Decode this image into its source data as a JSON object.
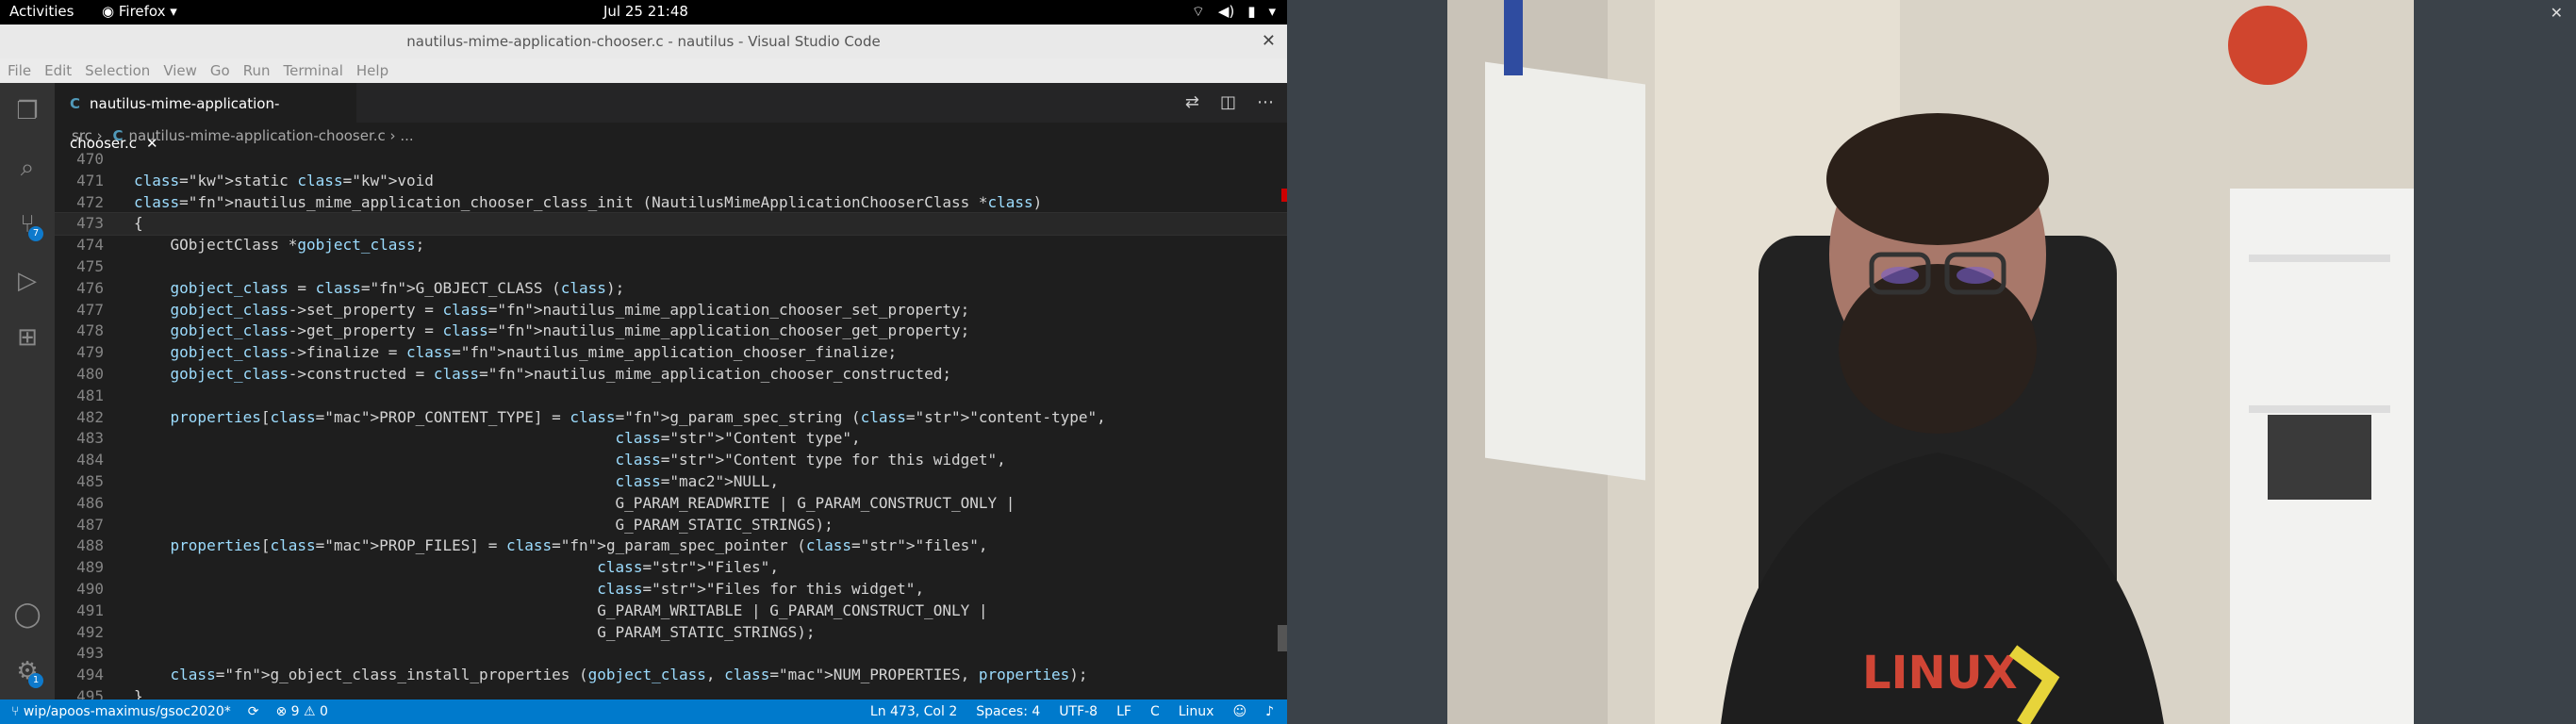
{
  "topbar": {
    "activities": "Activities",
    "app": "Firefox",
    "clock": "Jul 25  21:48"
  },
  "window": {
    "title": "nautilus-mime-application-chooser.c - nautilus - Visual Studio Code"
  },
  "menu": [
    "File",
    "Edit",
    "Selection",
    "View",
    "Go",
    "Run",
    "Terminal",
    "Help"
  ],
  "activity": {
    "scm_badge": "7",
    "settings_badge": "1"
  },
  "tab": {
    "label": "nautilus-mime-application-chooser.c",
    "lang": "C"
  },
  "breadcrumb": {
    "folder": "src",
    "file": "nautilus-mime-application-chooser.c",
    "more": "..."
  },
  "code": [
    {
      "n": "470",
      "t": ""
    },
    {
      "n": "471",
      "t": "static void"
    },
    {
      "n": "472",
      "t": "nautilus_mime_application_chooser_class_init (NautilusMimeApplicationChooserClass *class)"
    },
    {
      "n": "473",
      "t": "{"
    },
    {
      "n": "474",
      "t": "    GObjectClass *gobject_class;"
    },
    {
      "n": "475",
      "t": ""
    },
    {
      "n": "476",
      "t": "    gobject_class = G_OBJECT_CLASS (class);"
    },
    {
      "n": "477",
      "t": "    gobject_class->set_property = nautilus_mime_application_chooser_set_property;"
    },
    {
      "n": "478",
      "t": "    gobject_class->get_property = nautilus_mime_application_chooser_get_property;"
    },
    {
      "n": "479",
      "t": "    gobject_class->finalize = nautilus_mime_application_chooser_finalize;"
    },
    {
      "n": "480",
      "t": "    gobject_class->constructed = nautilus_mime_application_chooser_constructed;"
    },
    {
      "n": "481",
      "t": ""
    },
    {
      "n": "482",
      "t": "    properties[PROP_CONTENT_TYPE] = g_param_spec_string (\"content-type\","
    },
    {
      "n": "483",
      "t": "                                                     \"Content type\","
    },
    {
      "n": "484",
      "t": "                                                     \"Content type for this widget\","
    },
    {
      "n": "485",
      "t": "                                                     NULL,"
    },
    {
      "n": "486",
      "t": "                                                     G_PARAM_READWRITE | G_PARAM_CONSTRUCT_ONLY |"
    },
    {
      "n": "487",
      "t": "                                                     G_PARAM_STATIC_STRINGS);"
    },
    {
      "n": "488",
      "t": "    properties[PROP_FILES] = g_param_spec_pointer (\"files\","
    },
    {
      "n": "489",
      "t": "                                                   \"Files\","
    },
    {
      "n": "490",
      "t": "                                                   \"Files for this widget\","
    },
    {
      "n": "491",
      "t": "                                                   G_PARAM_WRITABLE | G_PARAM_CONSTRUCT_ONLY |"
    },
    {
      "n": "492",
      "t": "                                                   G_PARAM_STATIC_STRINGS);"
    },
    {
      "n": "493",
      "t": ""
    },
    {
      "n": "494",
      "t": "    g_object_class_install_properties (gobject_class, NUM_PROPERTIES, properties);"
    },
    {
      "n": "495",
      "t": "}"
    }
  ],
  "status": {
    "branch": "wip/apoos-maximus/gsoc2020*",
    "problems": "⊗ 9 ⚠ 0",
    "position": "Ln 473, Col 2",
    "spaces": "Spaces: 4",
    "encoding": "UTF-8",
    "eol": "LF",
    "language": "C",
    "os": "Linux"
  },
  "shirt_text": "LINUX"
}
